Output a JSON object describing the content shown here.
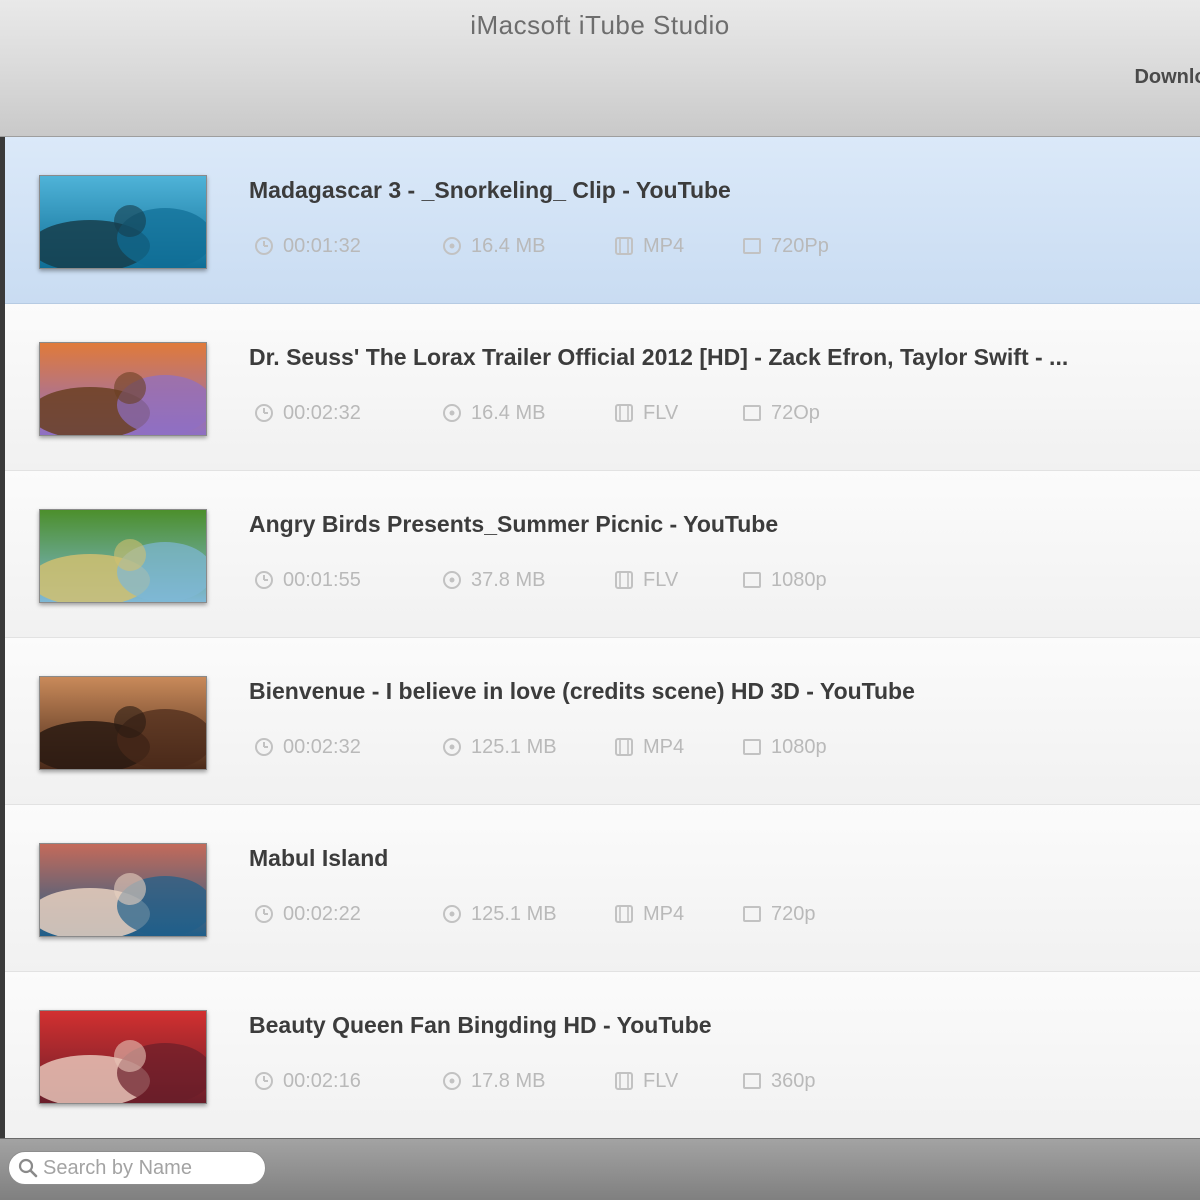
{
  "window": {
    "title": "iMacsoft iTube Studio"
  },
  "toolbar": {
    "download_label": "Download"
  },
  "videos": [
    {
      "title": "Madagascar 3 - _Snorkeling_ Clip - YouTube",
      "duration": "00:01:32",
      "size": "16.4 MB",
      "format": "MP4",
      "resolution": "720Pp",
      "thumb_colors": [
        "#0f6e96",
        "#4fb3d8",
        "#163e4c"
      ],
      "selected": true
    },
    {
      "title": "Dr. Seuss' The Lorax Trailer Official 2012 [HD] - Zack Efron, Taylor Swift - ...",
      "duration": "00:02:32",
      "size": "16.4 MB",
      "format": "FLV",
      "resolution": "72Op",
      "thumb_colors": [
        "#8e6fc4",
        "#e07a3a",
        "#6a3f22"
      ],
      "selected": false
    },
    {
      "title": "Angry Birds Presents_Summer Picnic - YouTube",
      "duration": "00:01:55",
      "size": "37.8 MB",
      "format": "FLV",
      "resolution": "1080p",
      "thumb_colors": [
        "#7fb8d6",
        "#4c8f2c",
        "#d0c070"
      ],
      "selected": false
    },
    {
      "title": "Bienvenue - I believe in love (credits scene) HD 3D - YouTube",
      "duration": "00:02:32",
      "size": "125.1 MB",
      "format": "MP4",
      "resolution": "1080p",
      "thumb_colors": [
        "#4a2a1a",
        "#c98a5a",
        "#2a1a12"
      ],
      "selected": false
    },
    {
      "title": "Mabul Island",
      "duration": "00:02:22",
      "size": "125.1 MB",
      "format": "MP4",
      "resolution": "720p",
      "thumb_colors": [
        "#1f5f8a",
        "#c46a5a",
        "#e8d0c0"
      ],
      "selected": false
    },
    {
      "title": "Beauty Queen Fan Bingding HD - YouTube",
      "duration": "00:02:16",
      "size": "17.8 MB",
      "format": "FLV",
      "resolution": "360p",
      "thumb_colors": [
        "#6a1e2a",
        "#d23030",
        "#e8c4b8"
      ],
      "selected": false
    }
  ],
  "search": {
    "placeholder": "Search by Name",
    "value": ""
  },
  "icons": {
    "duration": "clock-icon",
    "size": "disk-icon",
    "format": "film-icon",
    "resolution": "screen-icon",
    "search": "search-icon"
  }
}
